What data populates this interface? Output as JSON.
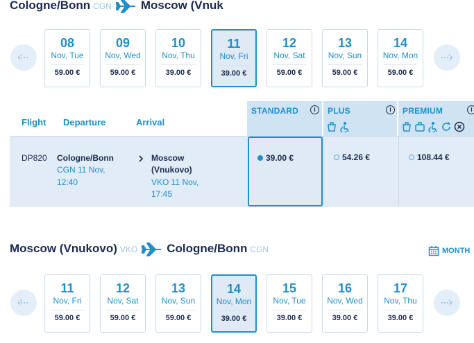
{
  "outbound": {
    "from_city": "Cologne/Bonn",
    "from_code": "CGN",
    "to_city": "Moscow (Vnuk",
    "days": [
      {
        "num": "08",
        "name": "Nov, Tue",
        "price": "59.00 €",
        "selected": false
      },
      {
        "num": "09",
        "name": "Nov, Wed",
        "price": "59.00 €",
        "selected": false
      },
      {
        "num": "10",
        "name": "Nov, Thu",
        "price": "39.00 €",
        "selected": false
      },
      {
        "num": "11",
        "name": "Nov, Fri",
        "price": "39.00 €",
        "selected": true
      },
      {
        "num": "12",
        "name": "Nov, Sat",
        "price": "59.00 €",
        "selected": false
      },
      {
        "num": "13",
        "name": "Nov, Sun",
        "price": "59.00 €",
        "selected": false
      },
      {
        "num": "14",
        "name": "Nov, Mon",
        "price": "59.00 €",
        "selected": false
      }
    ]
  },
  "table": {
    "col_flight": "Flight",
    "col_departure": "Departure",
    "col_arrival": "Arrival",
    "fares": [
      {
        "name": "STANDARD",
        "price": "39.00 €",
        "selected": true
      },
      {
        "name": "PLUS",
        "price": "54.26 €",
        "selected": false
      },
      {
        "name": "PREMIUM",
        "price": "108.44 €",
        "selected": false
      }
    ],
    "flight": {
      "number": "DP820",
      "dep_city": "Cologne/Bonn",
      "dep_line1": "CGN 11 Nov,",
      "dep_line2": "12:40",
      "arr_city1": "Moscow",
      "arr_city2": "(Vnukovo)",
      "arr_line1": "VKO 11 Nov,",
      "arr_line2": "17:45"
    }
  },
  "inbound": {
    "from_city": "Moscow (Vnukovo)",
    "from_code": "VKO",
    "to_city": "Cologne/Bonn",
    "to_code": "CGN",
    "month_label": "MONTH",
    "days": [
      {
        "num": "11",
        "name": "Nov, Fri",
        "price": "59.00 €",
        "selected": false
      },
      {
        "num": "12",
        "name": "Nov, Sat",
        "price": "59.00 €",
        "selected": false
      },
      {
        "num": "13",
        "name": "Nov, Sun",
        "price": "59.00 €",
        "selected": false
      },
      {
        "num": "14",
        "name": "Nov, Mon",
        "price": "39.00 €",
        "selected": true
      },
      {
        "num": "15",
        "name": "Nov, Tue",
        "price": "39.00 €",
        "selected": false
      },
      {
        "num": "16",
        "name": "Nov, Wed",
        "price": "39.00 €",
        "selected": false
      },
      {
        "num": "17",
        "name": "Nov, Thu",
        "price": "39.00 €",
        "selected": false
      }
    ]
  },
  "colors": {
    "accent": "#1f8ec9",
    "navy": "#1b2a4e",
    "light": "#e1ecf6"
  }
}
